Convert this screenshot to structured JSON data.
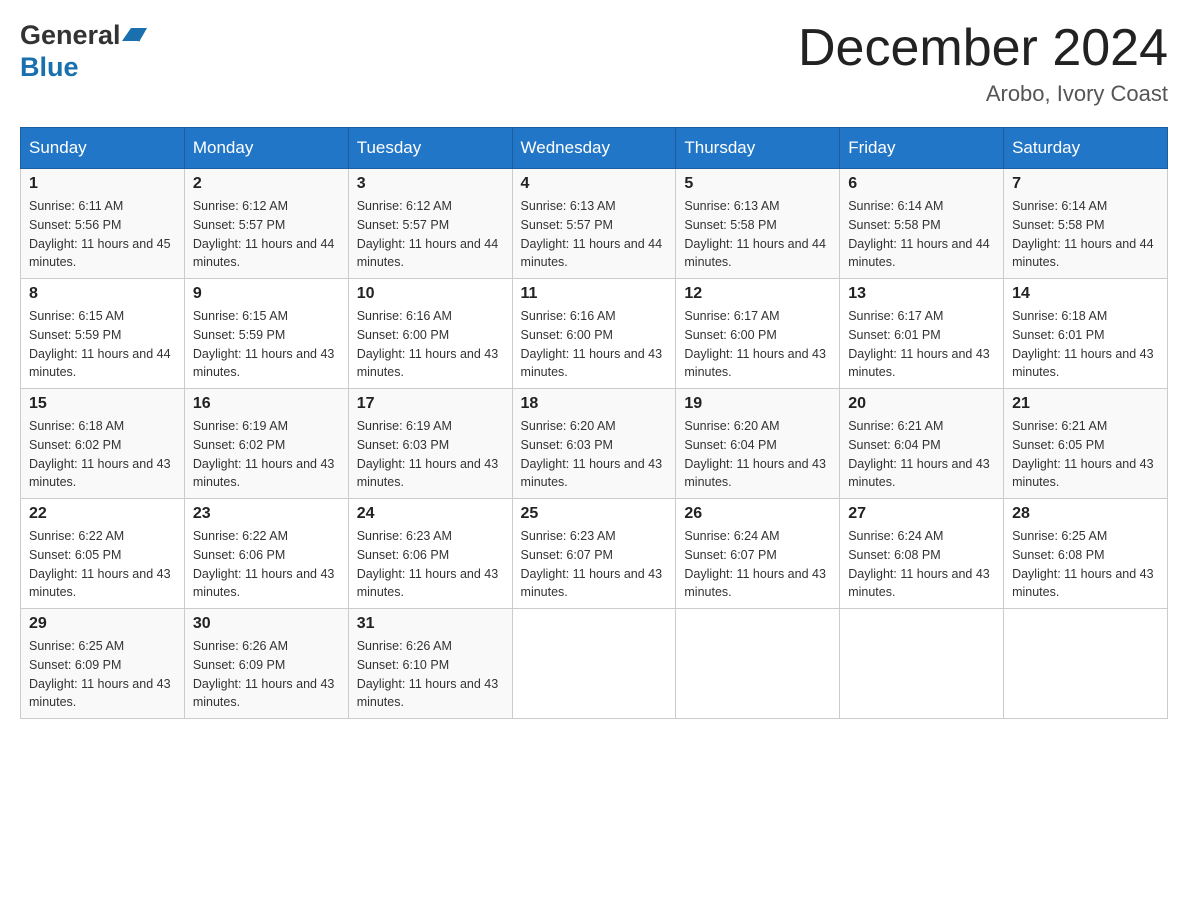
{
  "header": {
    "logo_general": "General",
    "logo_blue": "Blue",
    "month_title": "December 2024",
    "location": "Arobo, Ivory Coast"
  },
  "days_of_week": [
    "Sunday",
    "Monday",
    "Tuesday",
    "Wednesday",
    "Thursday",
    "Friday",
    "Saturday"
  ],
  "weeks": [
    [
      {
        "day": "1",
        "sunrise": "6:11 AM",
        "sunset": "5:56 PM",
        "daylight": "11 hours and 45 minutes."
      },
      {
        "day": "2",
        "sunrise": "6:12 AM",
        "sunset": "5:57 PM",
        "daylight": "11 hours and 44 minutes."
      },
      {
        "day": "3",
        "sunrise": "6:12 AM",
        "sunset": "5:57 PM",
        "daylight": "11 hours and 44 minutes."
      },
      {
        "day": "4",
        "sunrise": "6:13 AM",
        "sunset": "5:57 PM",
        "daylight": "11 hours and 44 minutes."
      },
      {
        "day": "5",
        "sunrise": "6:13 AM",
        "sunset": "5:58 PM",
        "daylight": "11 hours and 44 minutes."
      },
      {
        "day": "6",
        "sunrise": "6:14 AM",
        "sunset": "5:58 PM",
        "daylight": "11 hours and 44 minutes."
      },
      {
        "day": "7",
        "sunrise": "6:14 AM",
        "sunset": "5:58 PM",
        "daylight": "11 hours and 44 minutes."
      }
    ],
    [
      {
        "day": "8",
        "sunrise": "6:15 AM",
        "sunset": "5:59 PM",
        "daylight": "11 hours and 44 minutes."
      },
      {
        "day": "9",
        "sunrise": "6:15 AM",
        "sunset": "5:59 PM",
        "daylight": "11 hours and 43 minutes."
      },
      {
        "day": "10",
        "sunrise": "6:16 AM",
        "sunset": "6:00 PM",
        "daylight": "11 hours and 43 minutes."
      },
      {
        "day": "11",
        "sunrise": "6:16 AM",
        "sunset": "6:00 PM",
        "daylight": "11 hours and 43 minutes."
      },
      {
        "day": "12",
        "sunrise": "6:17 AM",
        "sunset": "6:00 PM",
        "daylight": "11 hours and 43 minutes."
      },
      {
        "day": "13",
        "sunrise": "6:17 AM",
        "sunset": "6:01 PM",
        "daylight": "11 hours and 43 minutes."
      },
      {
        "day": "14",
        "sunrise": "6:18 AM",
        "sunset": "6:01 PM",
        "daylight": "11 hours and 43 minutes."
      }
    ],
    [
      {
        "day": "15",
        "sunrise": "6:18 AM",
        "sunset": "6:02 PM",
        "daylight": "11 hours and 43 minutes."
      },
      {
        "day": "16",
        "sunrise": "6:19 AM",
        "sunset": "6:02 PM",
        "daylight": "11 hours and 43 minutes."
      },
      {
        "day": "17",
        "sunrise": "6:19 AM",
        "sunset": "6:03 PM",
        "daylight": "11 hours and 43 minutes."
      },
      {
        "day": "18",
        "sunrise": "6:20 AM",
        "sunset": "6:03 PM",
        "daylight": "11 hours and 43 minutes."
      },
      {
        "day": "19",
        "sunrise": "6:20 AM",
        "sunset": "6:04 PM",
        "daylight": "11 hours and 43 minutes."
      },
      {
        "day": "20",
        "sunrise": "6:21 AM",
        "sunset": "6:04 PM",
        "daylight": "11 hours and 43 minutes."
      },
      {
        "day": "21",
        "sunrise": "6:21 AM",
        "sunset": "6:05 PM",
        "daylight": "11 hours and 43 minutes."
      }
    ],
    [
      {
        "day": "22",
        "sunrise": "6:22 AM",
        "sunset": "6:05 PM",
        "daylight": "11 hours and 43 minutes."
      },
      {
        "day": "23",
        "sunrise": "6:22 AM",
        "sunset": "6:06 PM",
        "daylight": "11 hours and 43 minutes."
      },
      {
        "day": "24",
        "sunrise": "6:23 AM",
        "sunset": "6:06 PM",
        "daylight": "11 hours and 43 minutes."
      },
      {
        "day": "25",
        "sunrise": "6:23 AM",
        "sunset": "6:07 PM",
        "daylight": "11 hours and 43 minutes."
      },
      {
        "day": "26",
        "sunrise": "6:24 AM",
        "sunset": "6:07 PM",
        "daylight": "11 hours and 43 minutes."
      },
      {
        "day": "27",
        "sunrise": "6:24 AM",
        "sunset": "6:08 PM",
        "daylight": "11 hours and 43 minutes."
      },
      {
        "day": "28",
        "sunrise": "6:25 AM",
        "sunset": "6:08 PM",
        "daylight": "11 hours and 43 minutes."
      }
    ],
    [
      {
        "day": "29",
        "sunrise": "6:25 AM",
        "sunset": "6:09 PM",
        "daylight": "11 hours and 43 minutes."
      },
      {
        "day": "30",
        "sunrise": "6:26 AM",
        "sunset": "6:09 PM",
        "daylight": "11 hours and 43 minutes."
      },
      {
        "day": "31",
        "sunrise": "6:26 AM",
        "sunset": "6:10 PM",
        "daylight": "11 hours and 43 minutes."
      },
      null,
      null,
      null,
      null
    ]
  ]
}
